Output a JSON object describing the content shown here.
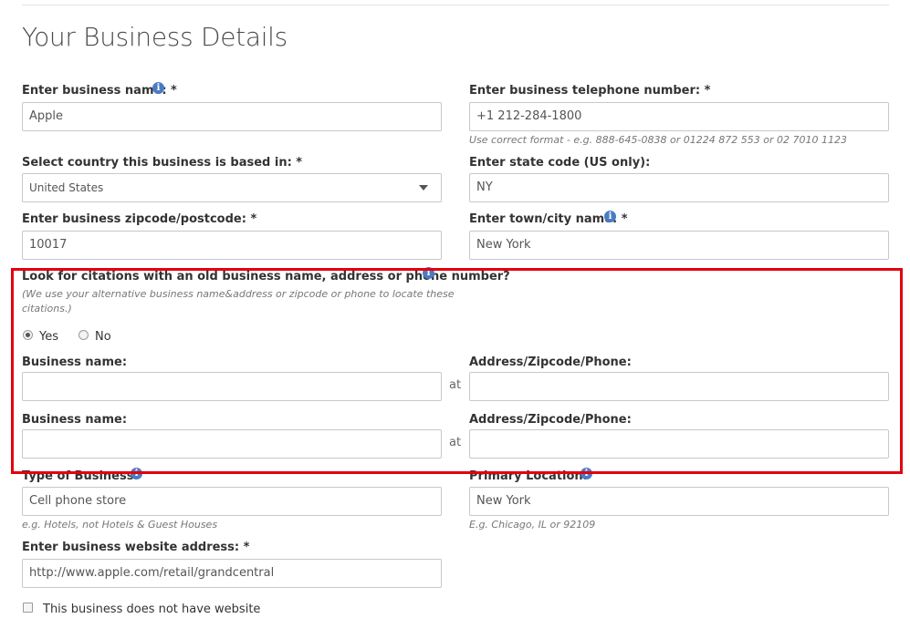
{
  "page": {
    "title": "Your Business Details"
  },
  "business_name": {
    "label": "Enter business name: *",
    "value": "Apple"
  },
  "phone": {
    "label": "Enter business telephone number: *",
    "value": "+1 212-284-1800",
    "hint": "Use correct format - e.g. 888-645-0838 or 01224 872 553 or 02 7010 1123"
  },
  "country": {
    "label": "Select country this business is based in: *",
    "value": "United States"
  },
  "state": {
    "label": "Enter state code (US only):",
    "value": "NY"
  },
  "zipcode": {
    "label": "Enter business zipcode/postcode: *",
    "value": "10017"
  },
  "city": {
    "label": "Enter town/city name: *",
    "value": "New York"
  },
  "citations": {
    "question": "Look for citations with an old business name, address or phone number?",
    "note_line1": "(We use your alternative business name&address or zipcode or phone to locate these",
    "note_line2": "citations.)",
    "yes_label": "Yes",
    "no_label": "No",
    "selected": "Yes",
    "rows": [
      {
        "name_label": "Business name:",
        "at": "at",
        "address_label": "Address/Zipcode/Phone:",
        "name_value": "",
        "address_value": ""
      },
      {
        "name_label": "Business name:",
        "at": "at",
        "address_label": "Address/Zipcode/Phone:",
        "name_value": "",
        "address_value": ""
      }
    ]
  },
  "type_of_business": {
    "label": "Type of Business:",
    "value": "Cell phone store",
    "hint": "e.g. Hotels, not Hotels & Guest Houses"
  },
  "primary_location": {
    "label": "Primary Location:",
    "value": "New York",
    "hint": "E.g. Chicago, IL or 92109"
  },
  "website": {
    "label": "Enter business website address: *",
    "value": "http://www.apple.com/retail/grandcentral",
    "no_website_label": "This business does not have website"
  },
  "icons": {
    "info": "info-icon",
    "caret": "chevron-down-icon"
  },
  "colors": {
    "highlight": "#e3000f",
    "info": "#4a7cc4"
  }
}
